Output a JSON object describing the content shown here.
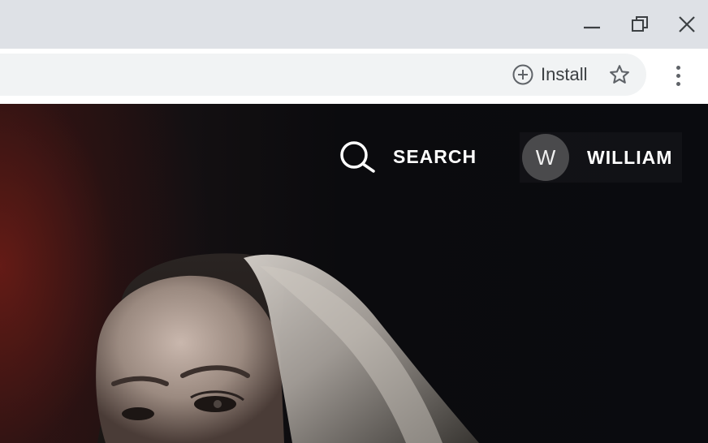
{
  "window_controls": {
    "minimize_icon": "minimize-icon",
    "restore_icon": "restore-icon",
    "close_icon": "close-icon"
  },
  "toolbar": {
    "install_label": "Install",
    "install_icon": "plus-circle-icon",
    "bookmark_icon": "star-icon",
    "menu_icon": "kebab-menu-icon"
  },
  "site_header": {
    "search_label": "SEARCH",
    "search_icon": "search-icon",
    "profile_initial": "W",
    "profile_name": "WILLIAM"
  },
  "colors": {
    "titlebar_bg": "#dee1e6",
    "toolbar_bg": "#ffffff",
    "omnibox_bg": "#f1f3f4",
    "content_bg": "#0d0d0f",
    "accent_red": "#6e1c16",
    "avatar_bg": "#4a4a4c"
  }
}
